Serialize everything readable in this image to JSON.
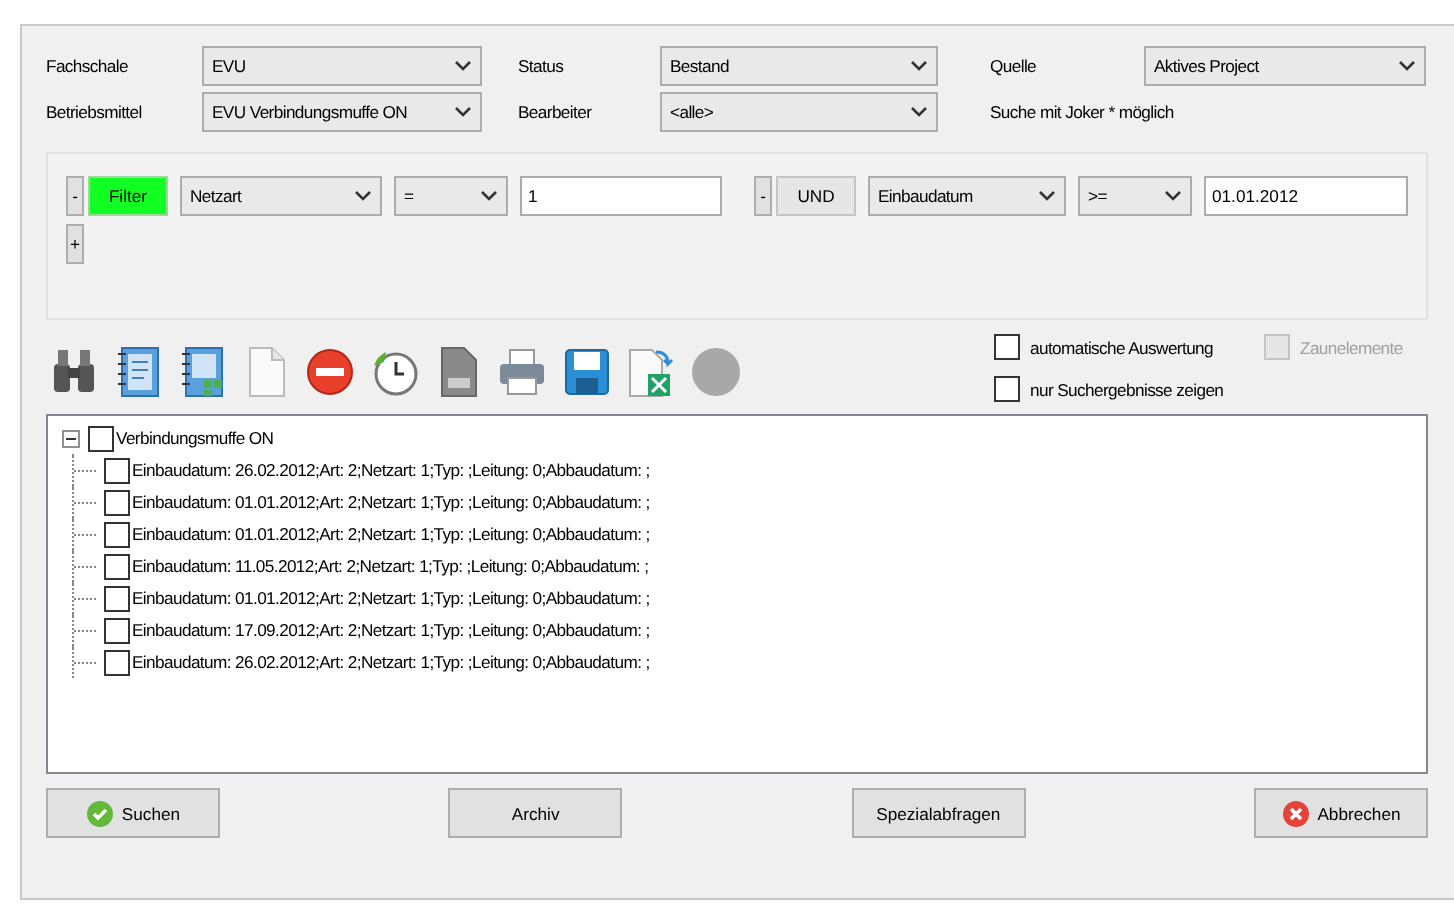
{
  "form": [
    {
      "label": "Fachschale",
      "value": "EVU"
    },
    {
      "label": "Status",
      "value": "Bestand"
    },
    {
      "label": "Quelle",
      "value": "Aktives Project"
    },
    {
      "label": "Betriebsmittel",
      "value": "EVU Verbindungsmuffe ON"
    },
    {
      "label": "Bearbeiter",
      "value": "<alle>"
    }
  ],
  "hint": "Suche mit Joker * möglich",
  "filters": [
    {
      "remove": "-",
      "operator_button": "Filter",
      "highlighted": true,
      "field": "Netzart",
      "comparison": "=",
      "value": "1"
    },
    {
      "remove": "-",
      "operator_button": "UND",
      "highlighted": false,
      "field": "Einbaudatum",
      "comparison": ">=",
      "value": "01.01.2012"
    }
  ],
  "add_button": "+",
  "options": [
    {
      "label": "automatische Auswertung",
      "checked": false,
      "disabled": false
    },
    {
      "label": "Zaunelemente",
      "checked": false,
      "disabled": true
    },
    {
      "label": "nur Suchergebnisse zeigen",
      "checked": false,
      "disabled": false
    }
  ],
  "tree": [
    {
      "label": "Verbindungsmuffe ON",
      "checked": false,
      "expanded": true,
      "children": [
        {
          "label": "Einbaudatum: 26.02.2012;Art: 2;Netzart: 1;Typ: ;Leitung: 0;Abbaudatum: ;",
          "checked": false
        },
        {
          "label": "Einbaudatum: 01.01.2012;Art: 2;Netzart: 1;Typ: ;Leitung: 0;Abbaudatum: ;",
          "checked": false
        },
        {
          "label": "Einbaudatum: 01.01.2012;Art: 2;Netzart: 1;Typ: ;Leitung: 0;Abbaudatum: ;",
          "checked": false
        },
        {
          "label": "Einbaudatum: 11.05.2012;Art: 2;Netzart: 1;Typ: ;Leitung: 0;Abbaudatum: ;",
          "checked": false
        },
        {
          "label": "Einbaudatum: 01.01.2012;Art: 2;Netzart: 1;Typ: ;Leitung: 0;Abbaudatum: ;",
          "checked": false
        },
        {
          "label": "Einbaudatum: 17.09.2012;Art: 2;Netzart: 1;Typ: ;Leitung: 0;Abbaudatum: ;",
          "checked": false
        },
        {
          "label": "Einbaudatum: 26.02.2012;Art: 2;Netzart: 1;Typ: ;Leitung: 0;Abbaudatum: ;",
          "checked": false
        }
      ]
    }
  ],
  "buttons": [
    {
      "label": "Suchen",
      "kind": "ok"
    },
    {
      "label": "Archiv",
      "kind": "plain"
    },
    {
      "label": "Spezialabfragen",
      "kind": "plain"
    },
    {
      "label": "Abbrechen",
      "kind": "cancel"
    }
  ]
}
